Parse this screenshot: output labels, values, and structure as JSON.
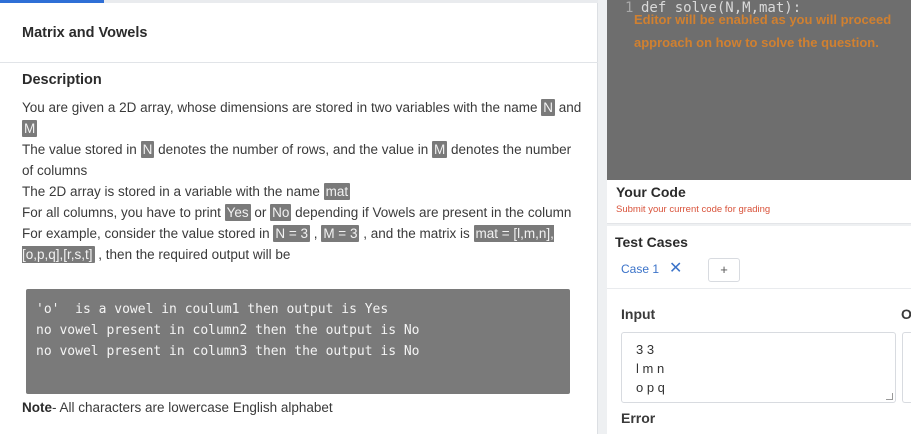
{
  "problem": {
    "title": "Matrix and Vowels",
    "description_heading": "Description",
    "description": {
      "p1_a": "You are given a 2D array, whose dimensions are stored in two variables with the name ",
      "p1_var_n": "N",
      "p1_and": " and ",
      "p1_var_m": "M",
      "p2_a": "The value stored in ",
      "p2_var_n": "N",
      "p2_b": " denotes the number of rows, and the value in ",
      "p2_var_m": "M",
      "p2_c": " denotes the number of columns",
      "p3_a": "The 2D array is stored in a variable with the name ",
      "p3_var": "mat",
      "p4_a": "For all columns, you have to print ",
      "p4_yes": "Yes",
      "p4_or": " or ",
      "p4_no": "No",
      "p4_b": " depending if Vowels are present in the column",
      "p5_a": "For example, consider the value stored in ",
      "p5_n": "N = 3",
      "p5_comma1": " , ",
      "p5_m": "M = 3",
      "p5_b": " , and the matrix is ",
      "p5_mat": "mat = [l,m,n],[o,p,q],[r,s,t]",
      "p5_c": " , then the required output will be"
    },
    "example_output": [
      "'o'  is a vowel in coulum1 then output is Yes",
      "no vowel present in column2 then the output is No",
      "no vowel present in column3 then the output is No"
    ],
    "note_label": "Note",
    "note_text": "- All characters are lowercase English alphabet"
  },
  "editor": {
    "line_number": "1",
    "code": "def solve(N,M,mat):",
    "overlay_message": "Editor will be enabled as you will proceed approach on how to solve the question."
  },
  "your_code": {
    "heading": "Your Code",
    "subtext": "Submit your current code for grading"
  },
  "test_cases": {
    "heading": "Test Cases",
    "case_tab_label": "Case 1",
    "add_label": "+",
    "input_label": "Input",
    "output_label": "O",
    "input_value": "3 3\nl m n\no p q",
    "error_label": "Error"
  },
  "colors": {
    "accent": "#2f6fd6",
    "highlight": "#7a7a7a",
    "editor_bg": "#6e6e6e",
    "overlay_text": "#d9822b",
    "subtext": "#d9533b"
  }
}
